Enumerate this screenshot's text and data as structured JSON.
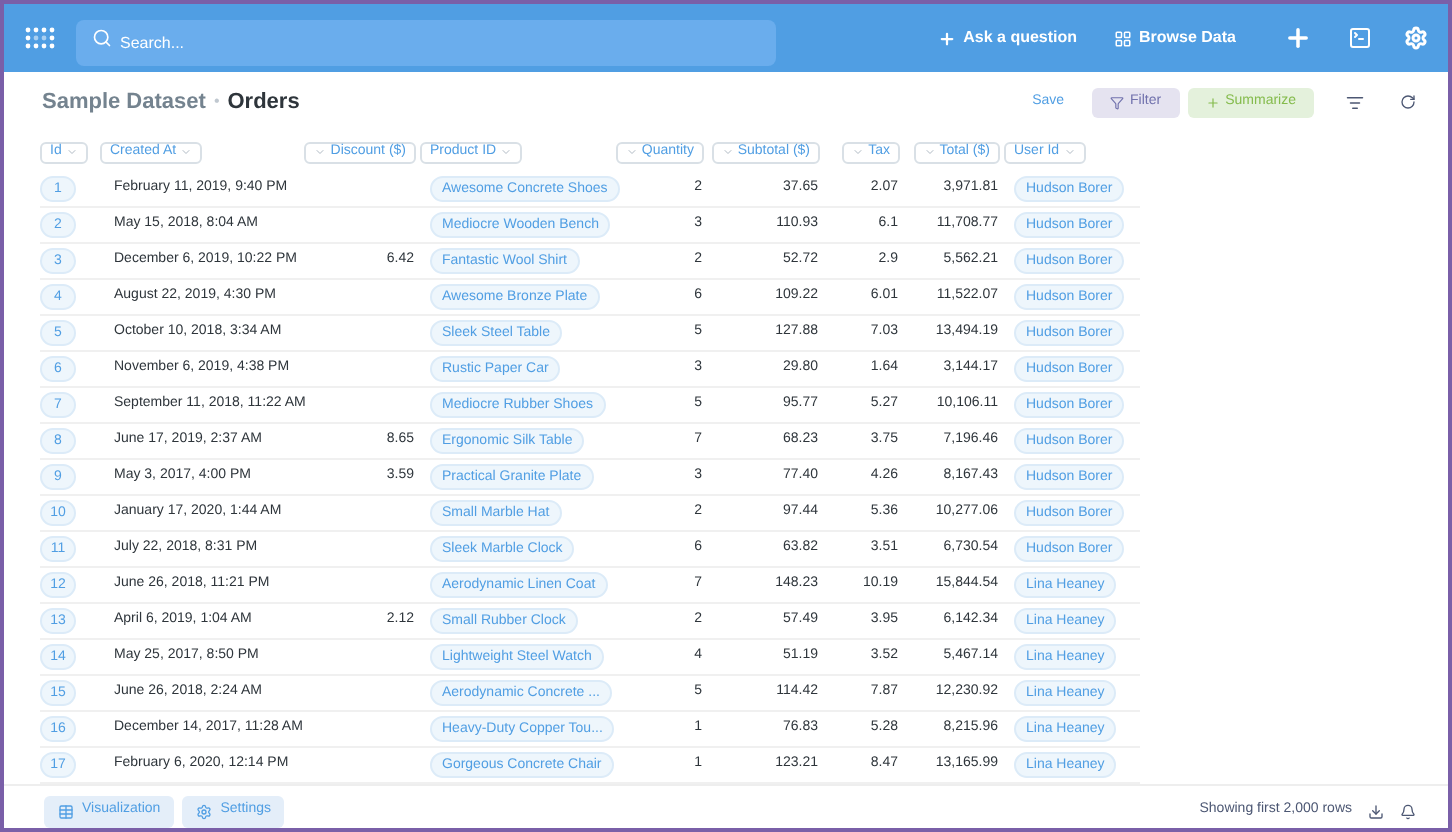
{
  "nav": {
    "search_placeholder": "Search...",
    "ask": "Ask a question",
    "browse": "Browse Data"
  },
  "header": {
    "database": "Sample Dataset",
    "separator": "•",
    "table": "Orders",
    "save": "Save",
    "filter": "Filter",
    "summarize": "Summarize"
  },
  "table": {
    "columns": [
      {
        "label": "Id"
      },
      {
        "label": "Created At"
      },
      {
        "label": "Discount ($)"
      },
      {
        "label": "Product ID"
      },
      {
        "label": "Quantity"
      },
      {
        "label": "Subtotal ($)"
      },
      {
        "label": "Tax"
      },
      {
        "label": "Total ($)"
      },
      {
        "label": "User Id"
      }
    ],
    "rows": [
      {
        "id": "1",
        "created": "February 11, 2019, 9:40 PM",
        "product": "Awesome Concrete Shoes",
        "quantity": "2",
        "subtotal": "37.65",
        "tax": "2.07",
        "total": "3,971.81",
        "user": "Hudson Borer"
      },
      {
        "id": "2",
        "created": "May 15, 2018, 8:04 AM",
        "product": "Mediocre Wooden Bench",
        "quantity": "3",
        "subtotal": "110.93",
        "tax": "6.1",
        "total": "11,708.77",
        "user": "Hudson Borer"
      },
      {
        "id": "3",
        "created": "December 6, 2019, 10:22 PM",
        "discount": "6.42",
        "product": "Fantastic Wool Shirt",
        "quantity": "2",
        "subtotal": "52.72",
        "tax": "2.9",
        "total": "5,562.21",
        "user": "Hudson Borer"
      },
      {
        "id": "4",
        "created": "August 22, 2019, 4:30 PM",
        "product": "Awesome Bronze Plate",
        "quantity": "6",
        "subtotal": "109.22",
        "tax": "6.01",
        "total": "11,522.07",
        "user": "Hudson Borer"
      },
      {
        "id": "5",
        "created": "October 10, 2018, 3:34 AM",
        "product": "Sleek Steel Table",
        "quantity": "5",
        "subtotal": "127.88",
        "tax": "7.03",
        "total": "13,494.19",
        "user": "Hudson Borer"
      },
      {
        "id": "6",
        "created": "November 6, 2019, 4:38 PM",
        "product": "Rustic Paper Car",
        "quantity": "3",
        "subtotal": "29.80",
        "tax": "1.64",
        "total": "3,144.17",
        "user": "Hudson Borer"
      },
      {
        "id": "7",
        "created": "September 11, 2018, 11:22 AM",
        "product": "Mediocre Rubber Shoes",
        "quantity": "5",
        "subtotal": "95.77",
        "tax": "5.27",
        "total": "10,106.11",
        "user": "Hudson Borer"
      },
      {
        "id": "8",
        "created": "June 17, 2019, 2:37 AM",
        "discount": "8.65",
        "product": "Ergonomic Silk Table",
        "quantity": "7",
        "subtotal": "68.23",
        "tax": "3.75",
        "total": "7,196.46",
        "user": "Hudson Borer"
      },
      {
        "id": "9",
        "created": "May 3, 2017, 4:00 PM",
        "discount": "3.59",
        "product": "Practical Granite Plate",
        "quantity": "3",
        "subtotal": "77.40",
        "tax": "4.26",
        "total": "8,167.43",
        "user": "Hudson Borer"
      },
      {
        "id": "10",
        "created": "January 17, 2020, 1:44 AM",
        "product": "Small Marble Hat",
        "quantity": "2",
        "subtotal": "97.44",
        "tax": "5.36",
        "total": "10,277.06",
        "user": "Hudson Borer"
      },
      {
        "id": "11",
        "created": "July 22, 2018, 8:31 PM",
        "product": "Sleek Marble Clock",
        "quantity": "6",
        "subtotal": "63.82",
        "tax": "3.51",
        "total": "6,730.54",
        "user": "Hudson Borer"
      },
      {
        "id": "12",
        "created": "June 26, 2018, 11:21 PM",
        "product": "Aerodynamic Linen Coat",
        "quantity": "7",
        "subtotal": "148.23",
        "tax": "10.19",
        "total": "15,844.54",
        "user": "Lina Heaney"
      },
      {
        "id": "13",
        "created": "April 6, 2019, 1:04 AM",
        "discount": "2.12",
        "product": "Small Rubber Clock",
        "quantity": "2",
        "subtotal": "57.49",
        "tax": "3.95",
        "total": "6,142.34",
        "user": "Lina Heaney"
      },
      {
        "id": "14",
        "created": "May 25, 2017, 8:50 PM",
        "product": "Lightweight Steel Watch",
        "quantity": "4",
        "subtotal": "51.19",
        "tax": "3.52",
        "total": "5,467.14",
        "user": "Lina Heaney"
      },
      {
        "id": "15",
        "created": "June 26, 2018, 2:24 AM",
        "product": "Aerodynamic Concrete ...",
        "quantity": "5",
        "subtotal": "114.42",
        "tax": "7.87",
        "total": "12,230.92",
        "user": "Lina Heaney"
      },
      {
        "id": "16",
        "created": "December 14, 2017, 11:28 AM",
        "product": "Heavy-Duty Copper Tou...",
        "quantity": "1",
        "subtotal": "76.83",
        "tax": "5.28",
        "total": "8,215.96",
        "user": "Lina Heaney"
      },
      {
        "id": "17",
        "created": "February 6, 2020, 12:14 PM",
        "product": "Gorgeous Concrete Chair",
        "quantity": "1",
        "subtotal": "123.21",
        "tax": "8.47",
        "total": "13,165.99",
        "user": "Lina Heaney"
      }
    ]
  },
  "footer": {
    "visualization": "Visualization",
    "settings": "Settings",
    "row_count": "Showing first 2,000 rows"
  }
}
